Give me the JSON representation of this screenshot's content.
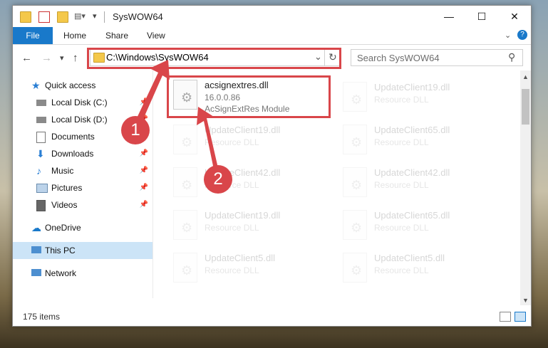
{
  "window": {
    "title": "SysWOW64",
    "controls": {
      "minimize": "—",
      "maximize": "☐",
      "close": "✕"
    }
  },
  "ribbon": {
    "tabs": [
      "File",
      "Home",
      "Share",
      "View"
    ]
  },
  "nav": {
    "back": "←",
    "forward": "→",
    "recent": "▾",
    "up": "↑",
    "address": "C:\\Windows\\SysWOW64",
    "address_dropdown": "⌄",
    "refresh": "↻",
    "search_placeholder": "Search SysWOW64",
    "search_icon": "⚲"
  },
  "sidebar": {
    "items": [
      {
        "label": "Quick access",
        "icon": "star-icon"
      },
      {
        "label": "Local Disk (C:)",
        "icon": "drive-icon",
        "pinned": true
      },
      {
        "label": "Local Disk (D:)",
        "icon": "drive-icon",
        "pinned": true
      },
      {
        "label": "Documents",
        "icon": "documents-icon",
        "pinned": true
      },
      {
        "label": "Downloads",
        "icon": "download-icon",
        "pinned": true
      },
      {
        "label": "Music",
        "icon": "music-icon",
        "pinned": true
      },
      {
        "label": "Pictures",
        "icon": "pictures-icon",
        "pinned": true
      },
      {
        "label": "Videos",
        "icon": "videos-icon",
        "pinned": true
      },
      {
        "label": "OneDrive",
        "icon": "cloud-icon"
      },
      {
        "label": "This PC",
        "icon": "computer-icon",
        "selected": true
      },
      {
        "label": "Network",
        "icon": "network-icon"
      }
    ],
    "pin_glyph": "📌"
  },
  "files": {
    "highlighted": {
      "name": "acsignextres.dll",
      "version": "16.0.0.86",
      "description": "AcSignExtRes Module"
    },
    "others": [
      {
        "name": "UpdateClient19.dll",
        "type": "Resource DLL"
      },
      {
        "name": "UpdateClient19.dll",
        "type": "Resource DLL"
      },
      {
        "name": "UpdateClient65.dll",
        "type": "Resource DLL"
      },
      {
        "name": "UpdateClient42.dll",
        "type": "Resource DLL"
      },
      {
        "name": "UpdateClient42.dll",
        "type": "Resource DLL"
      },
      {
        "name": "UpdateClient19.dll",
        "type": "Resource DLL"
      },
      {
        "name": "UpdateClient65.dll",
        "type": "Resource DLL"
      },
      {
        "name": "UpdateClient5.dll",
        "type": "Resource DLL"
      },
      {
        "name": "UpdateClient5.dll",
        "type": "Resource DLL"
      }
    ]
  },
  "status": {
    "items_count": "175 items"
  },
  "annotations": {
    "step1": "1",
    "step2": "2"
  },
  "colors": {
    "accent": "#1979ca",
    "highlight_red": "#d9464a",
    "selection": "#cce4f7"
  }
}
